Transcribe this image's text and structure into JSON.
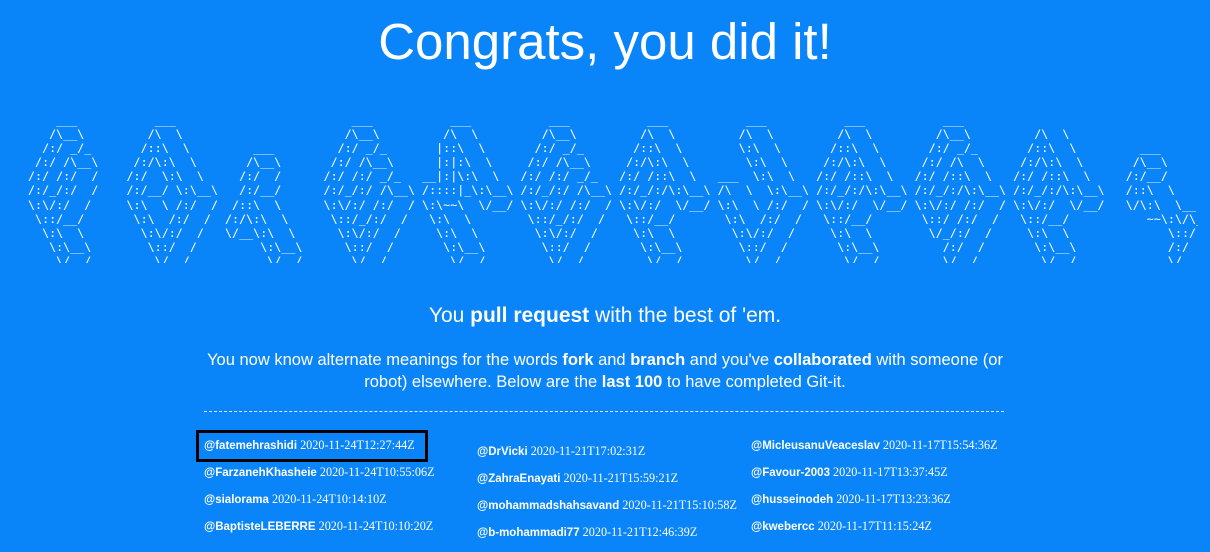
{
  "title": "Congrats, you did it!",
  "ascii_art": "    ___           ___                         ___           ___           ___           ___           ___           ___           ___                                     ___     \n   /\\__\\         /\\  \\                       /\\__\\         /\\  \\         /\\__\\         /\\  \\         /\\  \\         /\\  \\         /\\__\\         /\\  \\                       /\\  \\    \n  /:/ _/_       /::\\  \\         ___         /:/ _/_       |::\\  \\       /:/ _/_       /::\\  \\        \\:\\  \\       /::\\  \\       /:/ _/_       /::\\  \\         ___         /::\\  \\   \n /:/ /\\__\\     /:/\\:\\  \\       /\\__\\       /:/ /\\__\\      |:|:\\  \\     /:/ /\\__\\     /:/\\:\\  \\        \\:\\  \\     /:/\\:\\  \\     /:/ /\\  \\     /:/\\:\\  \\       /\\__\\       /:/\\:\\  \\  \n/:/ /:/  /    /:/  \\:\\  \\     /:/  /      /:/ /:/ _/_   __|:|\\:\\  \\   /:/ /:/ _/_   /:/ /::\\  \\   ___  \\:\\  \\   /:/ /::\\  \\   /:/ /::\\  \\   /:/ /::\\  \\     /:/__/      /:/  \\:\\__\\ \n/:/_/:/  /    /:/__/ \\:\\__\\   /:/__/      /:/_/:/ /\\__\\ /::::|_\\:\\__\\ /:/_/:/ /\\__\\ /:/_/:/\\:\\__\\ /\\  \\  \\:\\__\\ /:/_/:/\\:\\__\\ /:/_/:/\\:\\__\\ /:/_/:/\\:\\__\\   /::\\  \\     /:/__/ \\:|__|\n\\:\\/:/  /     \\:\\  \\ /:/  /  /::\\  \\      \\:\\/:/ /:/  / \\:\\~~\\  \\/__/ \\:\\/:/ /:/  / \\:\\/:/  \\/__/ \\:\\  \\ /:/  / \\:\\/:/  \\/__/ \\:\\/:/ /:/  / \\:\\/:/  \\/__/   \\/\\:\\  \\__  \\:\\  \\ /:/  /\n \\::/__/       \\:\\  /:/  /  /:/\\:\\  \\      \\::/_/:/  /   \\:\\  \\        \\::/_/:/  /   \\::/__/       \\:\\  /:/  /   \\::/__/       \\::/ /:/  /   \\::/__/           ~~\\:\\/\\__\\  \\:\\  /:/  / \n  \\:\\  \\        \\:\\/:/  /   \\/__\\:\\  \\      \\:\\/:/  /     \\:\\  \\        \\:\\/:/  /     \\:\\  \\        \\:\\/:/  /     \\:\\  \\        \\/_/:/  /     \\:\\  \\              \\::/  /   \\:\\/:/  /  \n   \\:\\__\\        \\::/  /         \\:\\__\\      \\::/  /       \\:\\__\\        \\::/  /       \\:\\__\\        \\::/  /       \\:\\__\\         /:/  /       \\:\\__\\             /:/  /     \\::/__/   \n    \\/__/         \\/__/           \\/__/       \\/__/         \\/__/         \\/__/         \\/__/         \\/__/         \\/__/         \\/__/         \\/__/             \\/__/       ~~       ",
  "subtitle": {
    "pre": "You ",
    "bold": "pull request",
    "post": " with the best of 'em."
  },
  "description": {
    "p1": "You now know alternate meanings for the words ",
    "b1": "fork",
    "p2": " and ",
    "b2": "branch",
    "p3": " and you've ",
    "b3": "collaborated",
    "p4": " with someone (or robot) elsewhere. Below are the ",
    "b4": "last 100",
    "p5": " to have completed Git-it."
  },
  "completions": {
    "col1": [
      {
        "user": "@fatemehrashidi",
        "time": "2020-11-24T12:27:44Z"
      },
      {
        "user": "@FarzanehKhasheie",
        "time": "2020-11-24T10:55:06Z"
      },
      {
        "user": "@sialorama",
        "time": "2020-11-24T10:14:10Z"
      },
      {
        "user": "@BaptisteLEBERRE",
        "time": "2020-11-24T10:10:20Z"
      }
    ],
    "col2": [
      {
        "user": "@DrVicki",
        "time": "2020-11-21T17:02:31Z"
      },
      {
        "user": "@ZahraEnayati",
        "time": "2020-11-21T15:59:21Z"
      },
      {
        "user": "@mohammadshahsavand",
        "time": "2020-11-21T15:10:58Z"
      },
      {
        "user": "@b-mohammadi77",
        "time": "2020-11-21T12:46:39Z"
      }
    ],
    "col3": [
      {
        "user": "@MicleusanuVeaceslav",
        "time": "2020-11-17T15:54:36Z"
      },
      {
        "user": "@Favour-2003",
        "time": "2020-11-17T13:37:45Z"
      },
      {
        "user": "@husseinodeh",
        "time": "2020-11-17T13:23:36Z"
      },
      {
        "user": "@kwebercc",
        "time": "2020-11-17T11:15:24Z"
      }
    ]
  },
  "colors": {
    "background": "#0a85f9",
    "text": "#ffffff",
    "highlight_border": "#000000"
  }
}
